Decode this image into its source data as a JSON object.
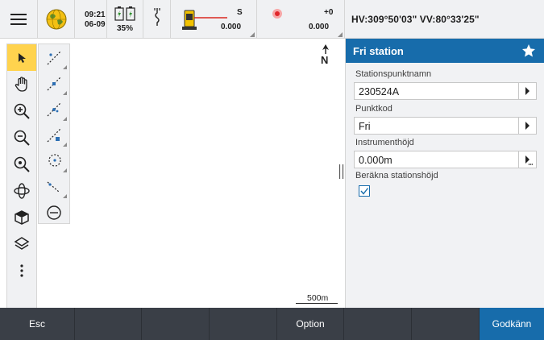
{
  "status": {
    "time": "09:21",
    "date": "06-09",
    "battery_percent": "35%",
    "instrument_s_label": "S",
    "instrument_s_value": "0.000",
    "offset_label": "+0",
    "offset_value": "0.000",
    "hv_readout": "HV:309°50'03\"  VV:80°33'25\""
  },
  "map": {
    "north_label": "N",
    "scale_label": "500m",
    "left_tools": [
      "select-arrow-icon",
      "pan-hand-icon",
      "zoom-in-icon",
      "zoom-out-icon",
      "zoom-extents-icon",
      "orbit-icon",
      "view-cube-icon",
      "layers-icon",
      "more-vertical-icon"
    ],
    "right_tools": [
      "cogo-line-icon",
      "cogo-point-a-icon",
      "cogo-point-b-icon",
      "cogo-point-c-icon",
      "cogo-circle-icon",
      "cogo-arc-icon",
      "minus-circle-icon"
    ]
  },
  "panel": {
    "title": "Fri station",
    "fields": [
      {
        "label": "Stationspunktnamn",
        "value": "230524A"
      },
      {
        "label": "Punktkod",
        "value": "Fri"
      },
      {
        "label": "Instrumenthöjd",
        "value": "0.000m"
      }
    ],
    "checkbox_label": "Beräkna stationshöjd",
    "checkbox_checked": true
  },
  "bottom_bar": {
    "esc_label": "Esc",
    "option_label": "Option",
    "accept_label": "Godkänn"
  },
  "colors": {
    "accent_blue": "#176cab",
    "bottom_bar": "#3a3f47",
    "toolbar_bg": "#f0f1f3"
  }
}
